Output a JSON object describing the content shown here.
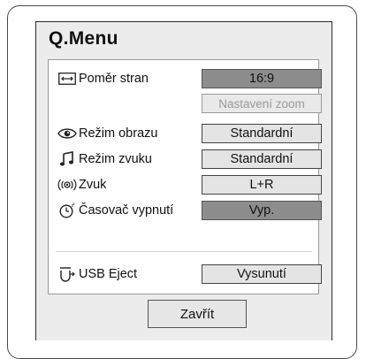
{
  "menu": {
    "title": "Q.Menu",
    "close_label": "Zavřít"
  },
  "items": {
    "aspect_ratio": {
      "label": "Poměr stran",
      "value": "16:9",
      "icon": "aspect-ratio-icon"
    },
    "zoom_settings": {
      "value": "Nastavení zoom"
    },
    "picture_mode": {
      "label": "Režim obrazu",
      "value": "Standardní",
      "icon": "eye-icon"
    },
    "sound_mode": {
      "label": "Režim zvuku",
      "value": "Standardní",
      "icon": "music-note-icon"
    },
    "audio": {
      "label": "Zvuk",
      "value": "L+R",
      "icon": "sound-wave-icon"
    },
    "sleep_timer": {
      "label": "Časovač vypnutí",
      "value": "Vyp.",
      "icon": "timer-clock-icon"
    },
    "usb_eject": {
      "label": "USB Eject",
      "value": "Vysunutí",
      "icon": "usb-eject-icon"
    }
  },
  "colors": {
    "panel_background": "#ececec",
    "selected_value_background": "#8d8d8d",
    "normal_value_background": "#e4e4e4",
    "disabled_text": "#9a9a9a"
  }
}
